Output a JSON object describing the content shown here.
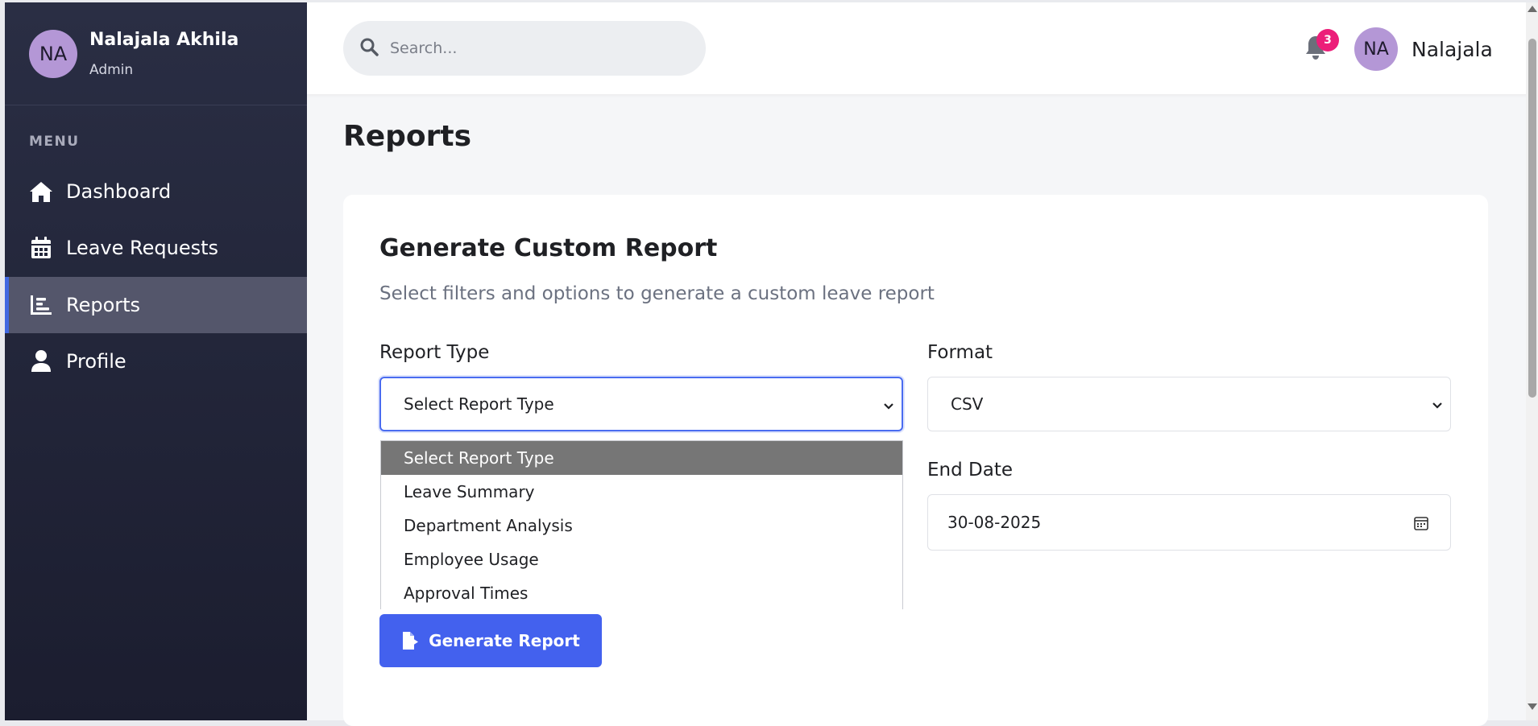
{
  "sidebar": {
    "user": {
      "initials": "NA",
      "name": "Nalajala Akhila",
      "role": "Admin"
    },
    "menu_label": "MENU",
    "items": [
      {
        "label": "Dashboard",
        "icon": "home-icon",
        "active": false
      },
      {
        "label": "Leave Requests",
        "icon": "calendar-icon",
        "active": false
      },
      {
        "label": "Reports",
        "icon": "chart-icon",
        "active": true
      },
      {
        "label": "Profile",
        "icon": "user-icon",
        "active": false
      }
    ]
  },
  "topbar": {
    "search_placeholder": "Search...",
    "notification_count": "3",
    "user_initials": "NA",
    "user_name": "Nalajala"
  },
  "page": {
    "title": "Reports",
    "card": {
      "title": "Generate Custom Report",
      "subtitle": "Select filters and options to generate a custom leave report",
      "report_type_label": "Report Type",
      "report_type_value": "Select Report Type",
      "format_label": "Format",
      "format_value": "CSV",
      "end_date_label": "End Date",
      "end_date_value": "30-08-2025",
      "report_type_options": [
        "Select Report Type",
        "Leave Summary",
        "Department Analysis",
        "Employee Usage",
        "Approval Times"
      ],
      "generate_button": "Generate Report"
    }
  },
  "colors": {
    "accent": "#4361ee",
    "sidebar_bg": "#1f2133",
    "avatar": "#b497d6",
    "badge": "#ec1e79"
  }
}
